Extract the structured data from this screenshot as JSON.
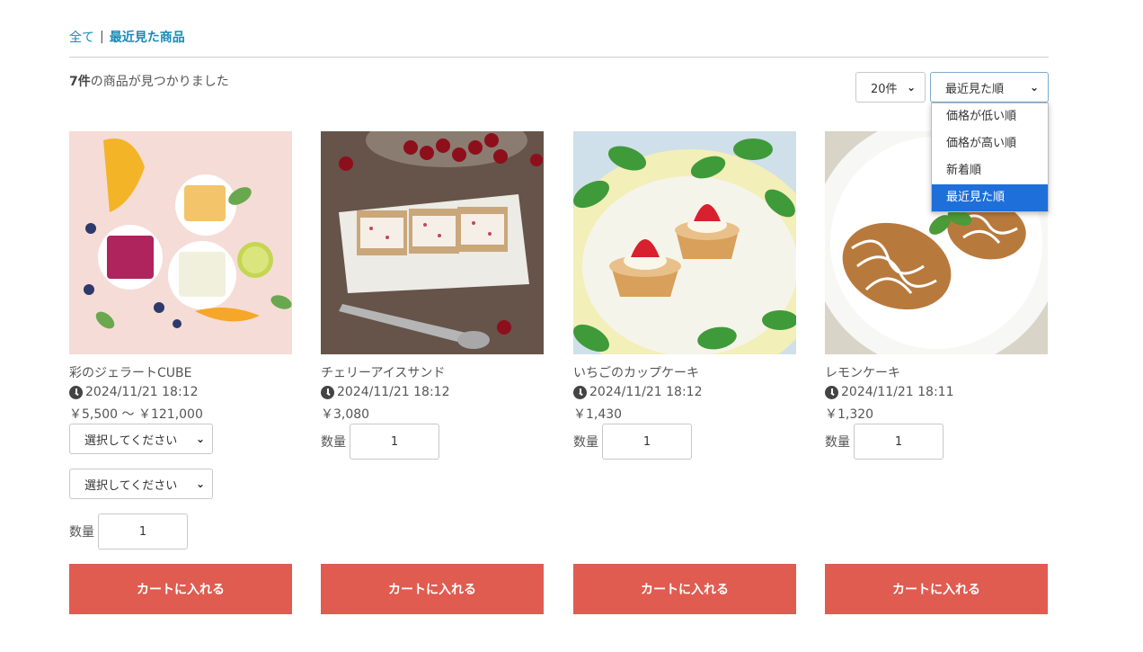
{
  "breadcrumb": {
    "all": "全て",
    "separator": "|",
    "current": "最近見た商品"
  },
  "result": {
    "count": "7件",
    "suffix": "の商品が見つかりました"
  },
  "per_page": {
    "value": "20件"
  },
  "sort": {
    "value": "最近見た順",
    "options": [
      "価格が低い順",
      "価格が高い順",
      "新着順",
      "最近見た順"
    ],
    "active_index": 3
  },
  "icons": {
    "dropdown": "chevron-down-icon",
    "date": "clock-icon"
  },
  "colors": {
    "accent": "#1a8ab5",
    "cart_button": "#e05c50",
    "dropdown_highlight": "#1e6fd9"
  },
  "products": [
    {
      "name": "彩のジェラートCUBE",
      "date": "2024/11/21 18:12",
      "price": "￥5,500 〜 ￥121,000",
      "option1": "選択してください",
      "option2": "選択してください",
      "qty_label": "数量",
      "qty": "1",
      "cart": "カートに入れる"
    },
    {
      "name": "チェリーアイスサンド",
      "date": "2024/11/21 18:12",
      "price": "￥3,080",
      "qty_label": "数量",
      "qty": "1",
      "cart": "カートに入れる"
    },
    {
      "name": "いちごのカップケーキ",
      "date": "2024/11/21 18:12",
      "price": "￥1,430",
      "qty_label": "数量",
      "qty": "1",
      "cart": "カートに入れる"
    },
    {
      "name": "レモンケーキ",
      "date": "2024/11/21 18:11",
      "price": "￥1,320",
      "qty_label": "数量",
      "qty": "1",
      "cart": "カートに入れる"
    }
  ]
}
